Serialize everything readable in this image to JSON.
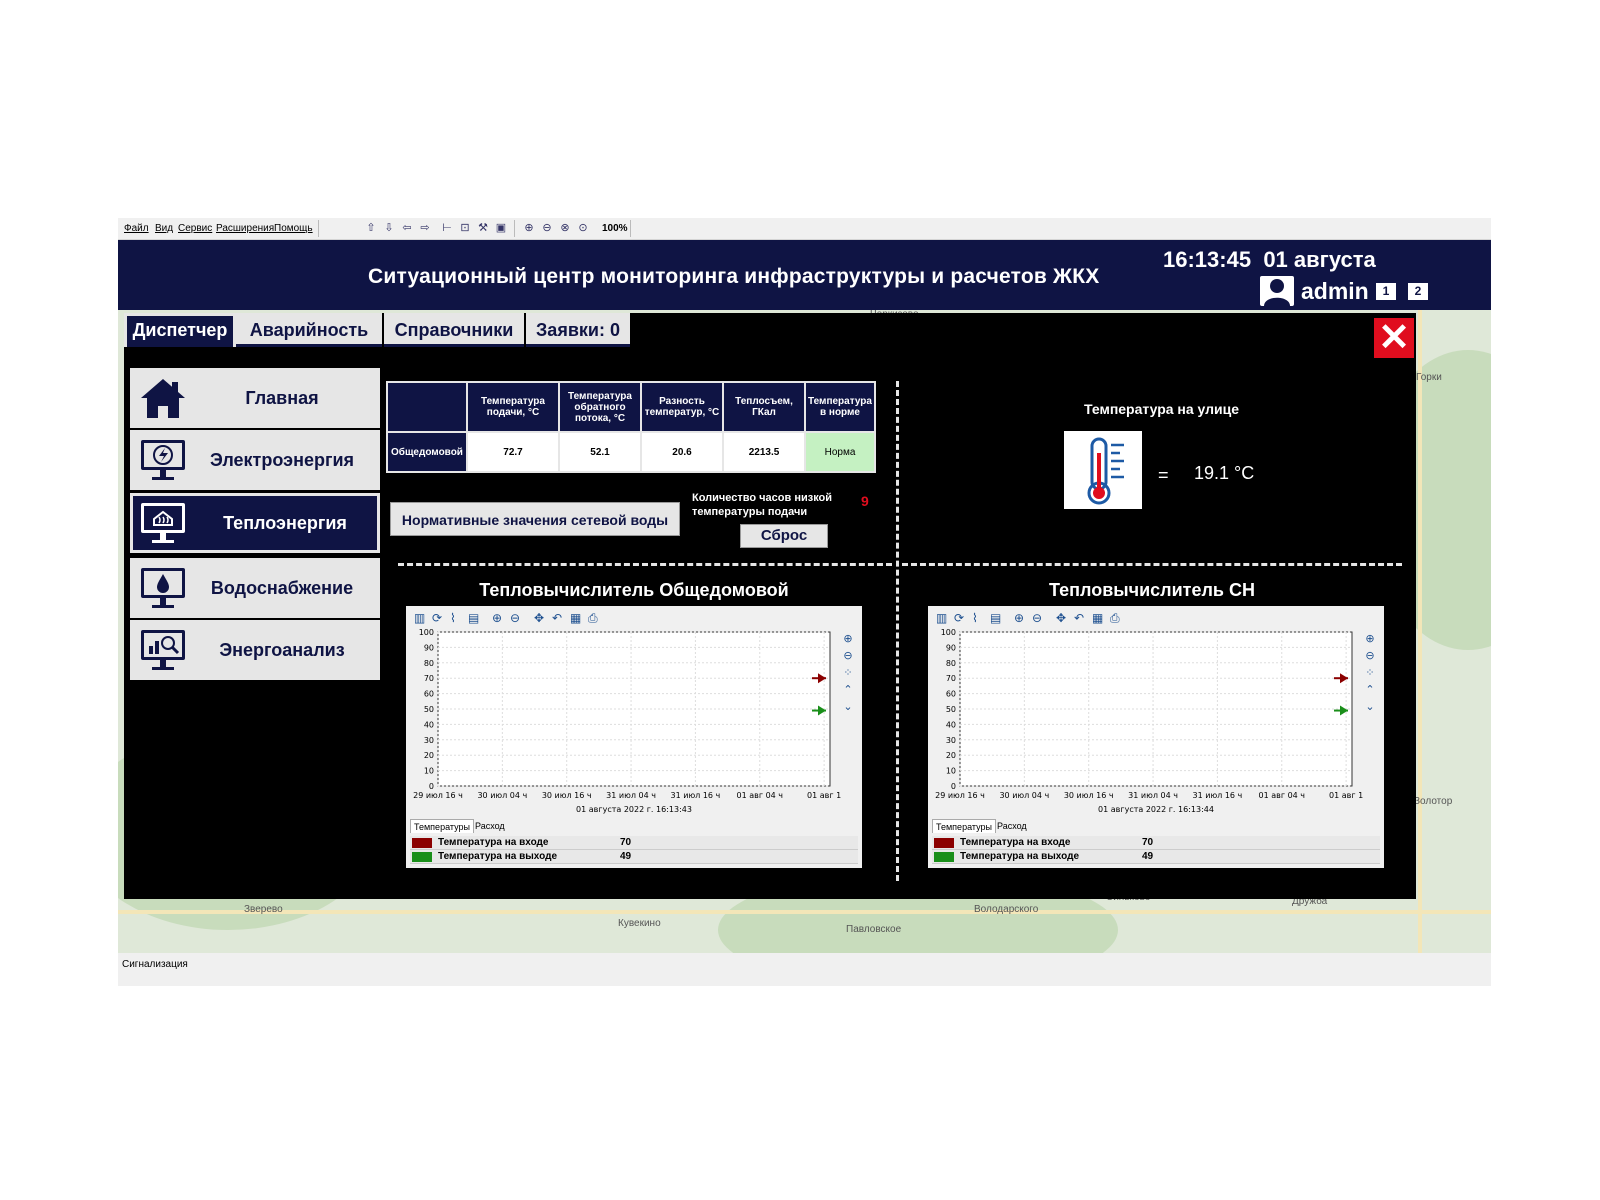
{
  "menu": [
    "Файл",
    "Вид",
    "Сервис",
    "Расширения",
    "Помощь"
  ],
  "toolbar": {
    "zoom": "100%"
  },
  "header": {
    "title": "Ситуационный центр мониторинга инфраструктуры и расчетов ЖКХ",
    "time": "16:13:45",
    "date": "01 августа",
    "user": "admin",
    "pages": [
      "1",
      "2"
    ]
  },
  "tabs": [
    {
      "label": "Диспетчер",
      "active": true
    },
    {
      "label": "Аварийность",
      "active": false
    },
    {
      "label": "Справочники",
      "active": false
    },
    {
      "label": "Заявки: 0",
      "active": false
    }
  ],
  "close_icon": "close-icon",
  "nav": [
    {
      "label": "Главная",
      "icon": "home-icon",
      "active": false
    },
    {
      "label": "Электроэнергия",
      "icon": "electricity-monitor-icon",
      "active": false
    },
    {
      "label": "Теплоэнергия",
      "icon": "heat-monitor-icon",
      "active": true
    },
    {
      "label": "Водоснабжение",
      "icon": "water-monitor-icon",
      "active": false
    },
    {
      "label": "Энергоанализ",
      "icon": "analysis-monitor-icon",
      "active": false
    }
  ],
  "table": {
    "headers": [
      "",
      "Температура подачи, °С",
      "Температура обратного потока, °С",
      "Разность температур, °С",
      "Теплосъем, ГКал",
      "Температура в норме"
    ],
    "rows": [
      {
        "name": "Общедомовой",
        "supply": "72.7",
        "return": "52.1",
        "diff": "20.6",
        "heat": "2213.5",
        "status": "Норма"
      }
    ]
  },
  "normative_button": "Нормативные значения сетевой воды",
  "low_temp": {
    "label": "Количество часов низкой температуры подачи",
    "count": "9",
    "reset": "Сброс"
  },
  "street": {
    "label": "Температура на улице",
    "eq": "=",
    "value": "19.1 °C",
    "icon": "thermometer-icon"
  },
  "map_places": [
    "Черкизово",
    "Горки",
    "Зверево",
    "Кувекино",
    "Павловское",
    "Володарского",
    "Синьково",
    "Дружба",
    "Золотор"
  ],
  "status_bar": "Сигнализация",
  "charts": [
    {
      "title": "Тепловычислитель Общедомовой",
      "timestamp": "01 августа 2022 г. 16:13:43",
      "tabs": [
        "Температуры",
        "Расход"
      ],
      "legend": [
        {
          "name": "Температура на входе",
          "value": "70",
          "color": "#8b0000"
        },
        {
          "name": "Температура на выходе",
          "value": "49",
          "color": "#1a8f1a"
        }
      ]
    },
    {
      "title": "Тепловычислитель СН",
      "timestamp": "01 августа 2022 г. 16:13:44",
      "tabs": [
        "Температуры",
        "Расход"
      ],
      "legend": [
        {
          "name": "Температура на входе",
          "value": "70",
          "color": "#8b0000"
        },
        {
          "name": "Температура на выходе",
          "value": "49",
          "color": "#1a8f1a"
        }
      ]
    }
  ],
  "chart_data": [
    {
      "type": "line",
      "title": "Тепловычислитель Общедомовой",
      "x_ticks": [
        "29 июл 16 ч",
        "30 июл 04 ч",
        "30 июл 16 ч",
        "31 июл 04 ч",
        "31 июл 16 ч",
        "01 авг 04 ч",
        "01 авг 1"
      ],
      "y_ticks": [
        0,
        10,
        20,
        30,
        40,
        50,
        60,
        70,
        80,
        90,
        100
      ],
      "ylim": [
        0,
        100
      ],
      "grid": true,
      "series": [
        {
          "name": "Температура на входе",
          "marker_value": 70,
          "color": "#8b0000"
        },
        {
          "name": "Температура на выходе",
          "marker_value": 49,
          "color": "#1a8f1a"
        }
      ]
    },
    {
      "type": "line",
      "title": "Тепловычислитель СН",
      "x_ticks": [
        "29 июл 16 ч",
        "30 июл 04 ч",
        "30 июл 16 ч",
        "31 июл 04 ч",
        "31 июл 16 ч",
        "01 авг 04 ч",
        "01 авг 1"
      ],
      "y_ticks": [
        0,
        10,
        20,
        30,
        40,
        50,
        60,
        70,
        80,
        90,
        100
      ],
      "ylim": [
        0,
        100
      ],
      "grid": true,
      "series": [
        {
          "name": "Температура на входе",
          "marker_value": 70,
          "color": "#8b0000"
        },
        {
          "name": "Температура на выходе",
          "marker_value": 49,
          "color": "#1a8f1a"
        }
      ]
    }
  ]
}
